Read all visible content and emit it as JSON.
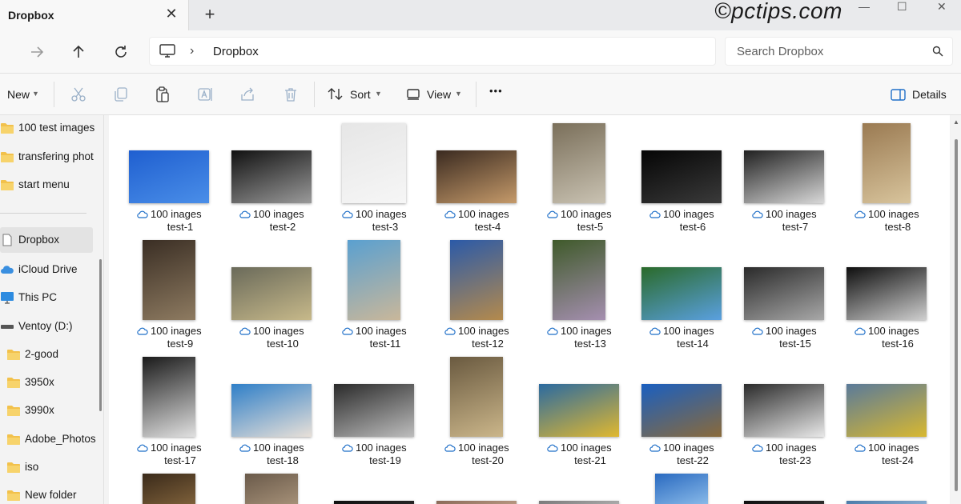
{
  "tab": {
    "title": "Dropbox",
    "close": "✕",
    "new": "+"
  },
  "watermark": "©pctips.com",
  "window": {
    "minimize": "—",
    "maximize": "☐",
    "close": "✕"
  },
  "address": {
    "crumb": "Dropbox",
    "separator": "›"
  },
  "search": {
    "placeholder": "Search Dropbox"
  },
  "toolbar": {
    "new_label": "New",
    "sort_label": "Sort",
    "view_label": "View",
    "more_label": "•••",
    "details_label": "Details"
  },
  "sidebar": {
    "items": [
      {
        "label": "100 test images",
        "icon": "folder-icon"
      },
      {
        "label": "transfering phot",
        "icon": "folder-icon"
      },
      {
        "label": "start menu",
        "icon": "folder-icon"
      },
      {
        "label": "Dropbox",
        "icon": "dropbox-file-icon",
        "selected": true
      },
      {
        "label": "iCloud Drive",
        "icon": "cloud-icon"
      },
      {
        "label": "This PC",
        "icon": "monitor-icon"
      },
      {
        "label": "Ventoy (D:)",
        "icon": "drive-icon"
      },
      {
        "label": "2-good",
        "icon": "folder-icon"
      },
      {
        "label": "3950x",
        "icon": "folder-icon"
      },
      {
        "label": "3990x",
        "icon": "folder-icon"
      },
      {
        "label": "Adobe_Photos",
        "icon": "folder-icon"
      },
      {
        "label": "iso",
        "icon": "folder-icon"
      },
      {
        "label": "New folder",
        "icon": "folder-icon"
      }
    ]
  },
  "files": [
    {
      "folder": "100 inages",
      "name": "test-1",
      "colors": [
        "#1f5fd0",
        "#4a8ee8"
      ]
    },
    {
      "folder": "100 inages",
      "name": "test-2",
      "colors": [
        "#111111",
        "#9a9a9a"
      ]
    },
    {
      "folder": "100 inages",
      "name": "test-3",
      "colors": [
        "#e6e6e6",
        "#f6f6f6"
      ]
    },
    {
      "folder": "100 inages",
      "name": "test-4",
      "colors": [
        "#3a2a20",
        "#c59a6a"
      ]
    },
    {
      "folder": "100 inages",
      "name": "test-5",
      "colors": [
        "#7a6f5a",
        "#c9c2b2"
      ]
    },
    {
      "folder": "100 inages",
      "name": "test-6",
      "colors": [
        "#050505",
        "#3a3a3a"
      ]
    },
    {
      "folder": "100 inages",
      "name": "test-7",
      "colors": [
        "#202020",
        "#d8d8d8"
      ]
    },
    {
      "folder": "100 inages",
      "name": "test-8",
      "colors": [
        "#9a7a52",
        "#d8c49c"
      ]
    },
    {
      "folder": "100 inages",
      "name": "test-9",
      "colors": [
        "#3a2e24",
        "#8e7b61"
      ]
    },
    {
      "folder": "100 inages",
      "name": "test-10",
      "colors": [
        "#6a6a5a",
        "#c7b98a"
      ]
    },
    {
      "folder": "100 inages",
      "name": "test-11",
      "colors": [
        "#5aa0d0",
        "#c9b79a"
      ]
    },
    {
      "folder": "100 inages",
      "name": "test-12",
      "colors": [
        "#2b5aa8",
        "#b48a4c"
      ]
    },
    {
      "folder": "100 inages",
      "name": "test-13",
      "colors": [
        "#3f5a2a",
        "#a58fb0"
      ]
    },
    {
      "folder": "100 inages",
      "name": "test-14",
      "colors": [
        "#2a6a2a",
        "#5aa0e0"
      ]
    },
    {
      "folder": "100 inages",
      "name": "test-15",
      "colors": [
        "#2a2a2a",
        "#a8a8a8"
      ]
    },
    {
      "folder": "100 inages",
      "name": "test-16",
      "colors": [
        "#0e0e0e",
        "#cfcfcf"
      ]
    },
    {
      "folder": "100 inages",
      "name": "test-17",
      "colors": [
        "#1a1a1a",
        "#e0e0e0"
      ]
    },
    {
      "folder": "100 inages",
      "name": "test-18",
      "colors": [
        "#2f7fc8",
        "#e8e0d8"
      ]
    },
    {
      "folder": "100 inages",
      "name": "test-19",
      "colors": [
        "#2a2a2a",
        "#bdbdbd"
      ]
    },
    {
      "folder": "100 inages",
      "name": "test-20",
      "colors": [
        "#6a5a40",
        "#cbb68a"
      ]
    },
    {
      "folder": "100 inages",
      "name": "test-21",
      "colors": [
        "#2b6aa0",
        "#e0b830"
      ]
    },
    {
      "folder": "100 inages",
      "name": "test-22",
      "colors": [
        "#1a5fc0",
        "#8a6a3a"
      ]
    },
    {
      "folder": "100 inages",
      "name": "test-23",
      "colors": [
        "#2a2a2a",
        "#e8e8e8"
      ]
    },
    {
      "folder": "100 inages",
      "name": "test-24",
      "colors": [
        "#5a7a9a",
        "#d8b830"
      ]
    }
  ],
  "partial_row": [
    {
      "colors": [
        "#3a2a1a",
        "#8a6a40"
      ]
    },
    {
      "colors": [
        "#6a5a4a",
        "#b09a80"
      ]
    },
    {
      "colors": [
        "#101010",
        "#303030"
      ]
    },
    {
      "colors": [
        "#8a6a58",
        "#c8a890"
      ]
    },
    {
      "colors": [
        "#7a7a7a",
        "#bdbdbd"
      ]
    },
    {
      "colors": [
        "#2a6ac0",
        "#9ac8f0"
      ]
    },
    {
      "colors": [
        "#101010",
        "#3a3a3a"
      ]
    },
    {
      "colors": [
        "#4a7aa8",
        "#a0c0e0"
      ]
    }
  ]
}
